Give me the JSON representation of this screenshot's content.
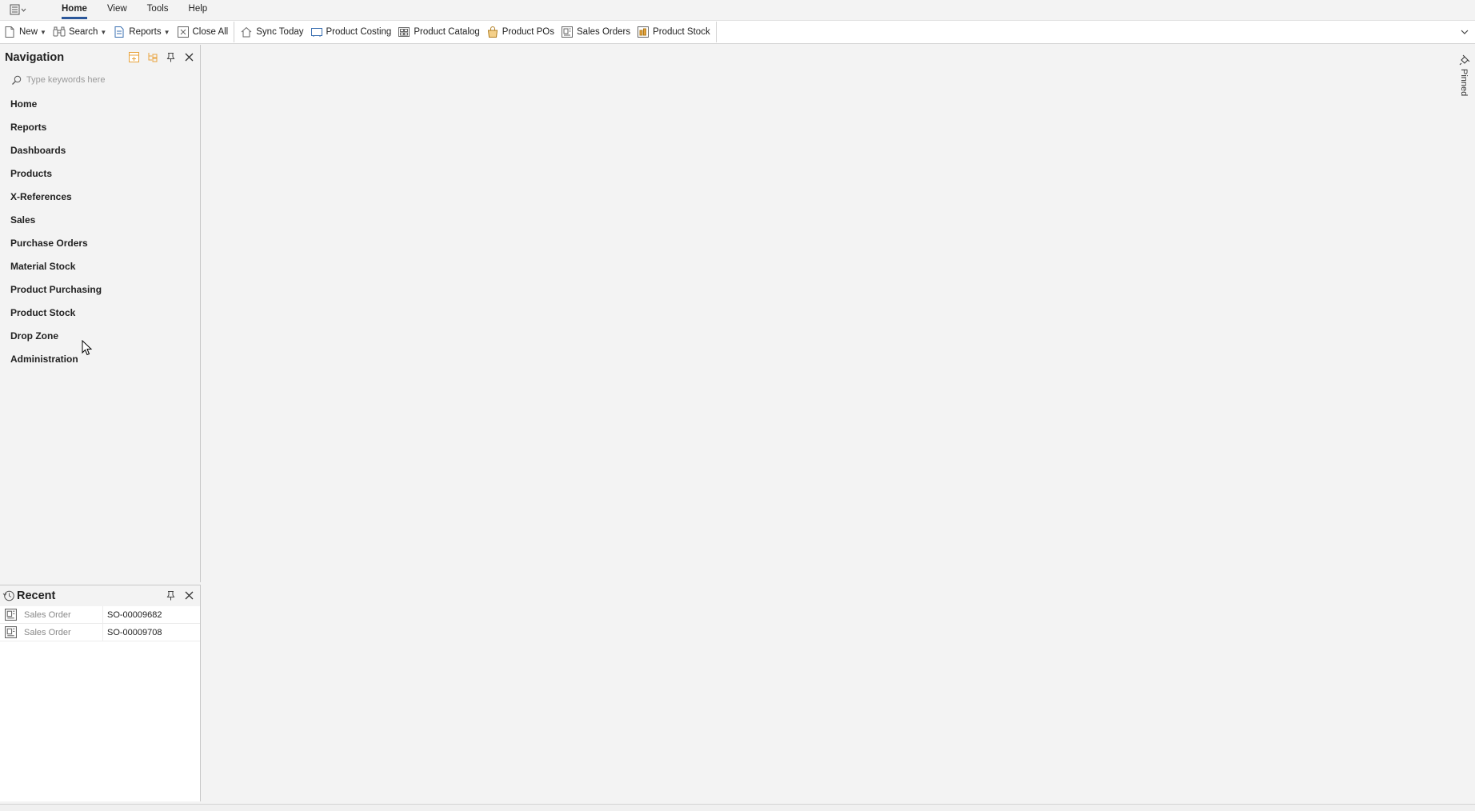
{
  "menubar": {
    "tabs": [
      {
        "label": "Home",
        "active": true
      },
      {
        "label": "View",
        "active": false
      },
      {
        "label": "Tools",
        "active": false
      },
      {
        "label": "Help",
        "active": false
      }
    ]
  },
  "toolbar": {
    "new_label": "New",
    "search_label": "Search",
    "reports_label": "Reports",
    "close_all_label": "Close All",
    "sync_today_label": "Sync Today",
    "product_costing_label": "Product Costing",
    "product_catalog_label": "Product Catalog",
    "product_pos_label": "Product POs",
    "sales_orders_label": "Sales Orders",
    "product_stock_label": "Product Stock"
  },
  "navigation": {
    "title": "Navigation",
    "search_placeholder": "Type keywords here",
    "items": [
      "Home",
      "Reports",
      "Dashboards",
      "Products",
      "X-References",
      "Sales",
      "Purchase Orders",
      "Material Stock",
      "Product Purchasing",
      "Product Stock",
      "Drop Zone",
      "Administration"
    ]
  },
  "recent": {
    "title": "Recent",
    "rows": [
      {
        "type": "Sales Order",
        "id": "SO-00009682"
      },
      {
        "type": "Sales Order",
        "id": "SO-00009708"
      }
    ]
  },
  "pinned": {
    "label": "Pinned"
  },
  "colors": {
    "accent": "#2b579a",
    "background": "#f3f3f3",
    "toolbar_bg": "#ffffff",
    "icon_orange": "#e8a33d"
  }
}
